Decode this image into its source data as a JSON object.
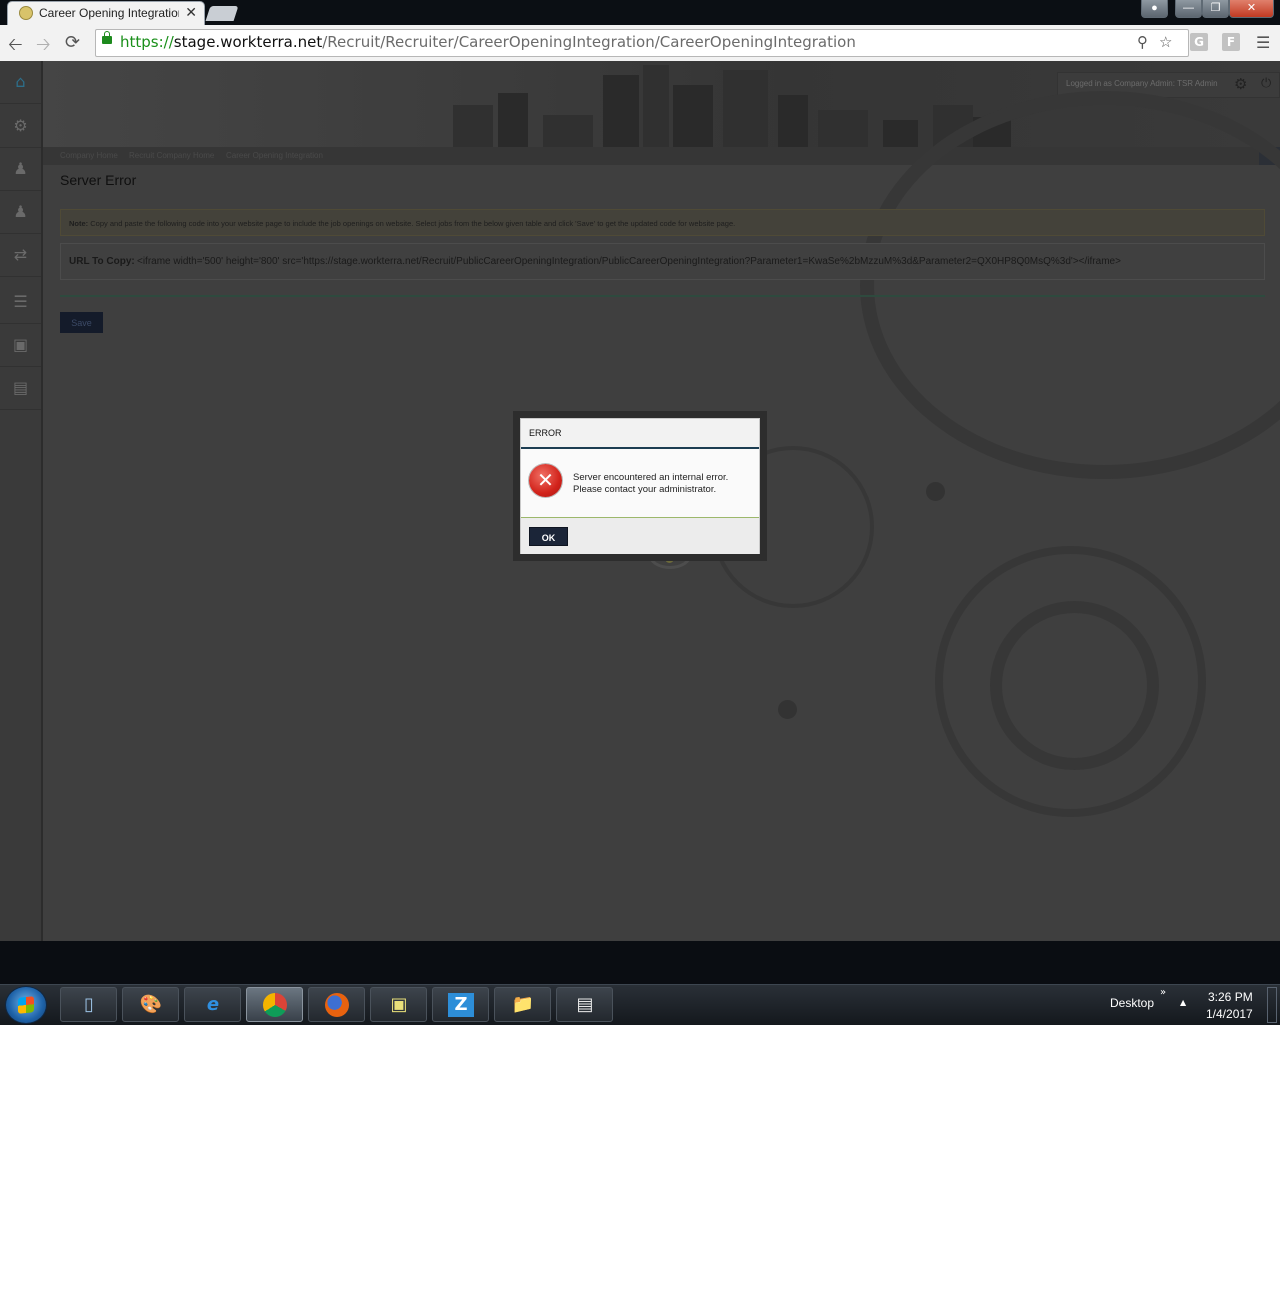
{
  "browser": {
    "tab_title": "Career Opening Integration",
    "tab_close": "✕",
    "url_scheme": "https://",
    "url_host": "stage.workterra.net",
    "url_path": "/Recruit/Recruiter/CareerOpeningIntegration/CareerOpeningIntegration",
    "extension_1": "G",
    "extension_2": "F"
  },
  "header": {
    "login_prefix": "Logged in as",
    "login_role": "Company Admin:",
    "login_user": "TSR Admin",
    "breadcrumb": [
      "Company Home",
      "Recruit Company Home",
      "Career Opening Integration"
    ]
  },
  "main": {
    "title": "Server Error",
    "note_label": "Note:",
    "note_text": "Copy and paste the following code into your website page to include the job openings on website. Select jobs from the below given table and click 'Save' to get the updated code for website page.",
    "url_label": "URL To Copy:",
    "url_code": "<iframe width='500' height='800' src='https://stage.workterra.net/Recruit/PublicCareerOpeningIntegration/PublicCareerOpeningIntegration?Parameter1=KwaSe%2bMzzuM%3d&Parameter2=QX0HP8Q0MsQ%3d'></iframe>",
    "save_label": "Save"
  },
  "modal": {
    "title": "ERROR",
    "message": "Server encountered an internal error. Please contact your administrator.",
    "ok_label": "OK",
    "icon": "error-icon"
  },
  "taskbar": {
    "apps": [
      "explorer",
      "paint",
      "internet-explorer",
      "chrome",
      "firefox",
      "sticky-notes",
      "z-app",
      "file-explorer",
      "notepad"
    ],
    "active_app": "chrome",
    "z_app_letter": "Z",
    "desktop_label": "Desktop",
    "time": "3:26 PM",
    "date": "1/4/2017"
  },
  "colors": {
    "overlay_bg": "#3f3f3f",
    "modal_header_border": "#1c3d52",
    "ok_button": "#1b2538",
    "url_secure": "#1a8f1a",
    "error_red": "#d2231b"
  }
}
